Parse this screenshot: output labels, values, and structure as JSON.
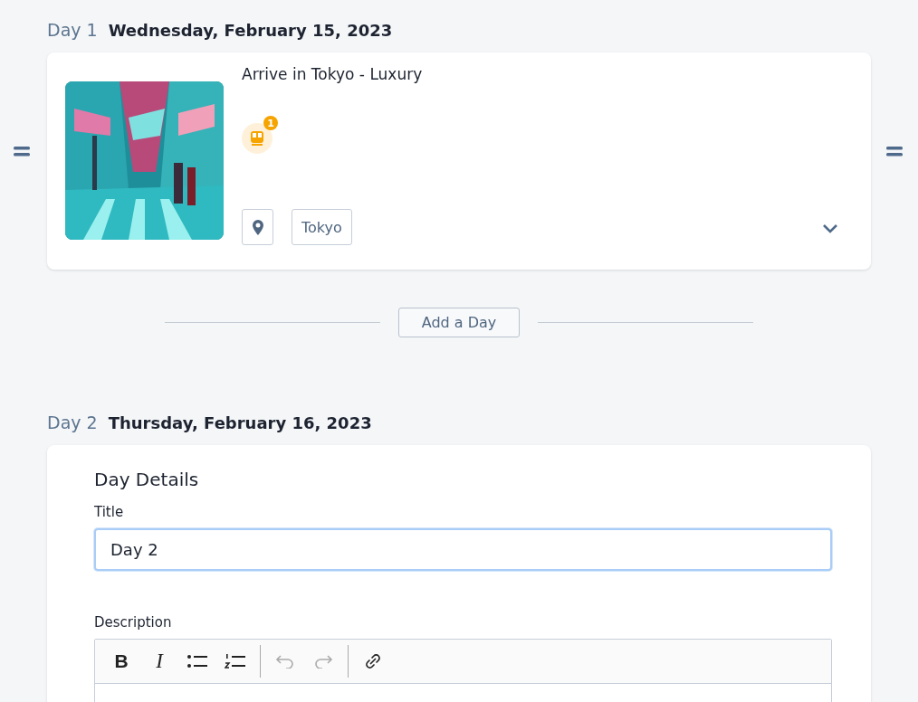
{
  "days": [
    {
      "kind": "summary",
      "label": "Day 1",
      "date": "Wednesday, February 15, 2023",
      "title": "Arrive in Tokyo - Luxury",
      "transport_count": "1",
      "location": "Tokyo",
      "expanded": false
    },
    {
      "kind": "edit",
      "label": "Day 2",
      "date": "Thursday, February 16, 2023",
      "section_title": "Day Details",
      "title_label": "Title",
      "title_value": "Day 2",
      "title_focused": true,
      "description_label": "Description",
      "toolbar": [
        {
          "kind": "bold",
          "text": "B",
          "disabled": false
        },
        {
          "kind": "italic",
          "text": "I",
          "disabled": false
        },
        {
          "kind": "bullets",
          "disabled": false
        },
        {
          "kind": "numbers",
          "disabled": false
        },
        {
          "kind": "sep"
        },
        {
          "kind": "undo",
          "disabled": true
        },
        {
          "kind": "redo",
          "disabled": true
        },
        {
          "kind": "sep"
        },
        {
          "kind": "link",
          "disabled": false
        }
      ]
    }
  ],
  "add_day_button": "Add a Day"
}
